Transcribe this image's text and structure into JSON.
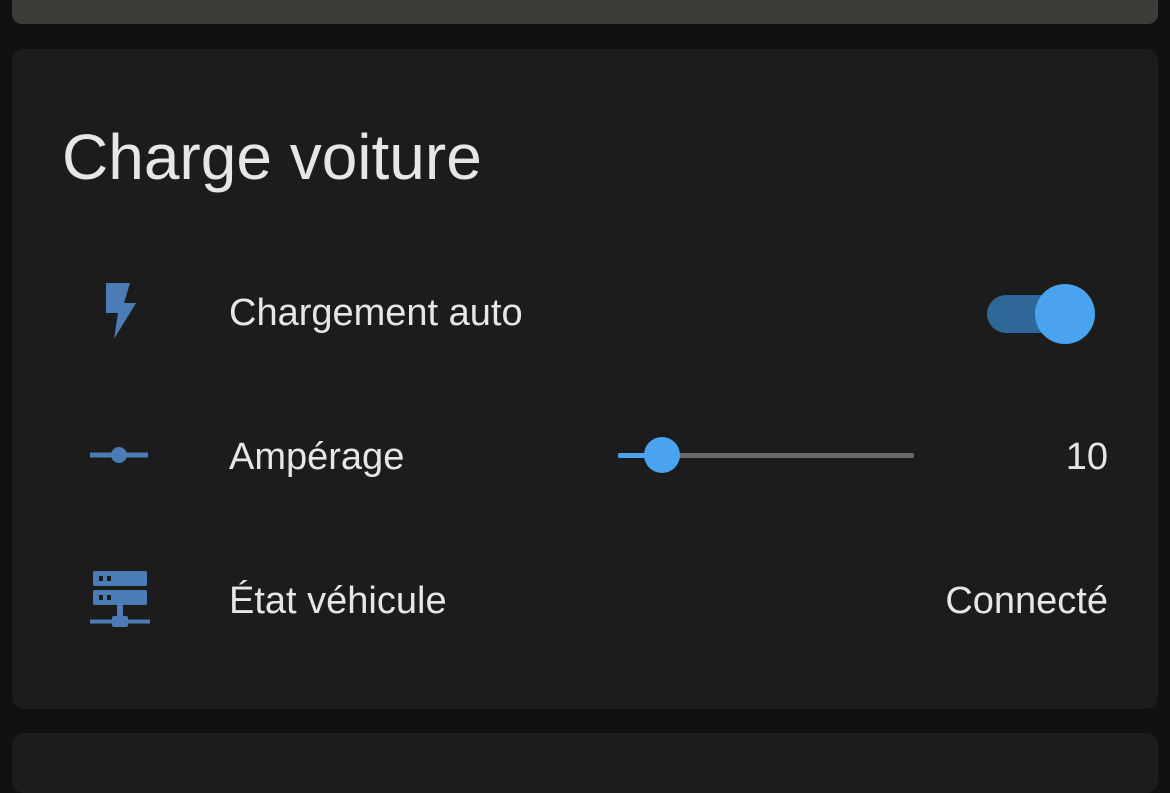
{
  "card": {
    "title": "Charge voiture",
    "rows": [
      {
        "label": "Chargement auto",
        "icon": "flash-icon",
        "control": "toggle",
        "toggle_on": true
      },
      {
        "label": "Ampérage",
        "icon": "slider-icon",
        "control": "slider",
        "value": "10",
        "slider_fraction": 0.15
      },
      {
        "label": "État véhicule",
        "icon": "server-network-icon",
        "value": "Connecté"
      }
    ]
  },
  "colors": {
    "accent": "#4aa3ee",
    "icon": "#4b7cb5",
    "toggle_track": "#2f6898",
    "card_bg": "#1c1c1c",
    "page_bg": "#111111"
  }
}
